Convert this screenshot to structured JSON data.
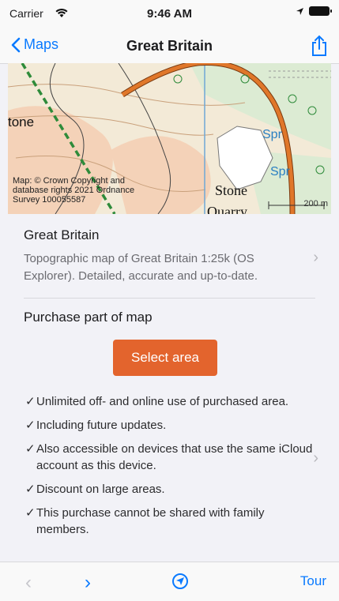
{
  "status_bar": {
    "carrier": "Carrier",
    "time": "9:46 AM"
  },
  "nav": {
    "back_label": "Maps",
    "title": "Great Britain"
  },
  "map": {
    "credit_line1": "Map: © Crown Copyright and",
    "credit_line2": "database rights 2021 Ordnance",
    "credit_line3": "Survey 100055587",
    "scale_label": "200 m",
    "labels": [
      "tone",
      "Spr",
      "Spr",
      "Stone",
      "Quarry"
    ]
  },
  "product": {
    "title": "Great Britain",
    "description": "Topographic map of Great Britain 1:25k (OS Explorer). Detailed, accurate and up-to-date."
  },
  "purchase": {
    "heading": "Purchase part of map",
    "button_label": "Select area",
    "check_mark": "✓",
    "benefits": [
      "Unlimited off- and online use of purchased area.",
      "Including future updates.",
      "Also accessible on devices that use the same iCloud account as this device.",
      "Discount on large areas.",
      "This purchase cannot be shared with family members."
    ]
  },
  "toolbar": {
    "prev": "‹",
    "next": "›",
    "tour_label": "Tour"
  },
  "colors": {
    "accent": "#0a7aff",
    "button": "#e3642d"
  },
  "icons": [
    "chevron-left-icon",
    "share-icon",
    "location-arrow-icon",
    "chevron-right-icon"
  ]
}
